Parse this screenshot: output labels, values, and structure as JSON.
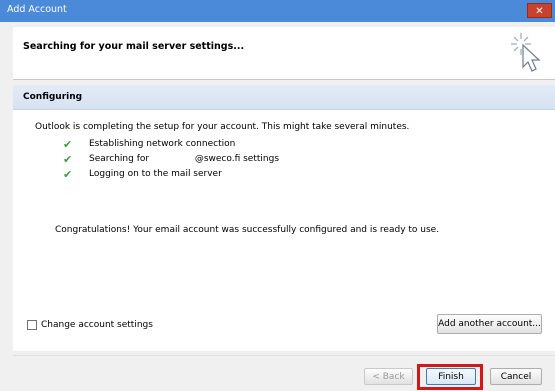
{
  "window": {
    "title": "Add Account",
    "close_glyph": "✕"
  },
  "header": {
    "heading": "Searching for your mail server settings...",
    "icon": "loading-cursor-icon"
  },
  "section": {
    "title": "Configuring"
  },
  "status_message": "Outlook is completing the setup for your account. This might take several minutes.",
  "steps": [
    {
      "label": "Establishing network connection",
      "icon": "checkmark-icon",
      "state": "done"
    },
    {
      "label": "Searching for                @sweco.fi settings",
      "icon": "checkmark-icon",
      "state": "done"
    },
    {
      "label": "Logging on to the mail server",
      "icon": "checkmark-icon",
      "state": "done"
    }
  ],
  "check_glyph": "✔",
  "congratulations": "Congratulations! Your email account was successfully configured and is ready to use.",
  "change_settings": {
    "label": "Change account settings",
    "checked": false
  },
  "add_another_label": "Add another account...",
  "buttons": {
    "back": "< Back",
    "finish": "Finish",
    "cancel": "Cancel"
  },
  "colors": {
    "titlebar": "#4a8ad8",
    "check": "#3a9f3a",
    "highlight": "#d21818"
  }
}
